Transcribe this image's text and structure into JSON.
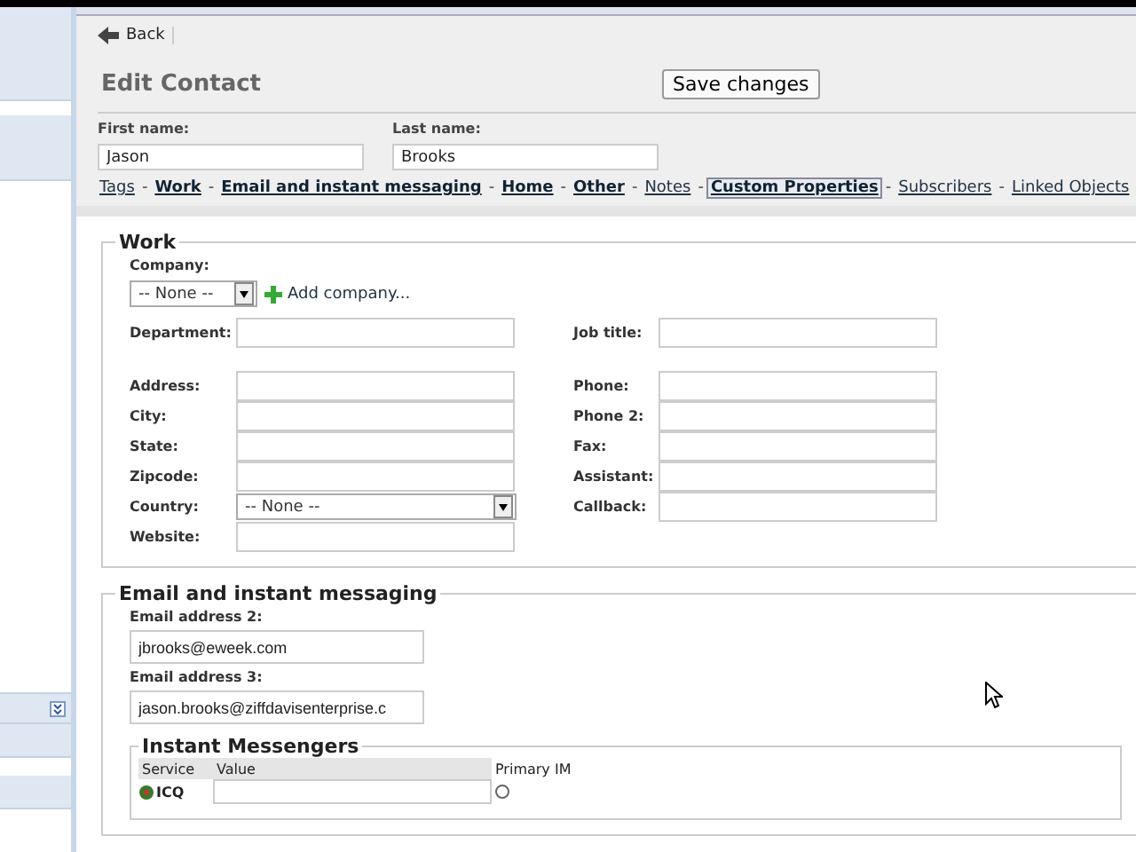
{
  "toolbar": {
    "back": "Back"
  },
  "header": {
    "title": "Edit Contact",
    "save_button": "Save changes"
  },
  "name_fields": [
    {
      "label": "First name:",
      "value": "Jason"
    },
    {
      "label": "Last name:",
      "value": "Brooks"
    }
  ],
  "nav_links": [
    {
      "label": "Tags",
      "bold": false,
      "selected": false
    },
    {
      "label": "Work",
      "bold": true,
      "selected": false
    },
    {
      "label": "Email and instant messaging",
      "bold": true,
      "selected": false
    },
    {
      "label": "Home",
      "bold": true,
      "selected": false
    },
    {
      "label": "Other",
      "bold": true,
      "selected": false
    },
    {
      "label": "Notes",
      "bold": false,
      "selected": false
    },
    {
      "label": "Custom Properties",
      "bold": true,
      "selected": true
    },
    {
      "label": "Subscribers",
      "bold": false,
      "selected": false
    },
    {
      "label": "Linked Objects",
      "bold": false,
      "selected": false
    }
  ],
  "separator": "-",
  "work": {
    "title": "Work",
    "company_label": "Company:",
    "company_value": "-- None --",
    "add_company": "Add company...",
    "left_top": {
      "label": "Department:",
      "kind": "text"
    },
    "right_top": {
      "label": "Job title:",
      "kind": "text"
    },
    "left_fields": [
      {
        "label": "Address:",
        "kind": "text"
      },
      {
        "label": "City:",
        "kind": "text"
      },
      {
        "label": "State:",
        "kind": "text"
      },
      {
        "label": "Zipcode:",
        "kind": "text"
      },
      {
        "label": "Country:",
        "kind": "select",
        "value": "-- None --"
      },
      {
        "label": "Website:",
        "kind": "text"
      }
    ],
    "right_fields": [
      {
        "label": "Phone:",
        "kind": "text"
      },
      {
        "label": "Phone 2:",
        "kind": "text"
      },
      {
        "label": "Fax:",
        "kind": "text"
      },
      {
        "label": "Assistant:",
        "kind": "text"
      },
      {
        "label": "Callback:",
        "kind": "text"
      }
    ]
  },
  "email": {
    "title": "Email and instant messaging",
    "fields": [
      {
        "label": "Email address 2:",
        "value": "jbrooks@eweek.com"
      },
      {
        "label": "Email address 3:",
        "value": "jason.brooks@ziffdavisenterprise.c"
      }
    ],
    "im": {
      "title": "Instant Messengers",
      "columns": [
        "Service",
        "Value",
        "Primary IM"
      ],
      "rows": [
        {
          "service": "ICQ",
          "checked": false
        }
      ]
    }
  }
}
